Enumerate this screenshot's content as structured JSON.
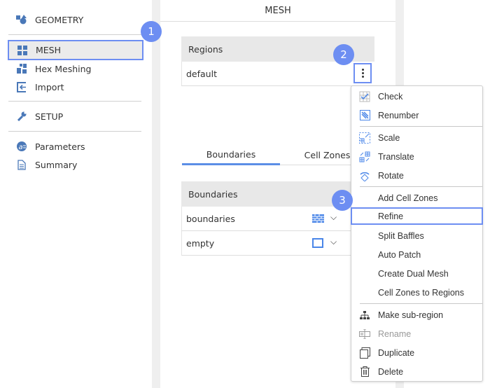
{
  "sidebar": {
    "items": [
      {
        "label": "GEOMETRY",
        "icon": "geometry-icon"
      },
      {
        "label": "MESH",
        "icon": "mesh-grid-icon",
        "selected": true
      },
      {
        "label": "Hex Meshing",
        "icon": "hex-meshing-icon"
      },
      {
        "label": "Import",
        "icon": "import-icon"
      },
      {
        "label": "SETUP",
        "icon": "wrench-icon"
      },
      {
        "label": "Parameters",
        "icon": "parameters-icon"
      },
      {
        "label": "Summary",
        "icon": "document-icon"
      }
    ]
  },
  "main": {
    "title": "MESH",
    "regions": {
      "header": "Regions",
      "rows": [
        "default"
      ],
      "menu_button_icon": "kebab-icon"
    },
    "tabs": [
      {
        "label": "Boundaries",
        "active": true
      },
      {
        "label": "Cell Zones"
      }
    ],
    "boundaries": {
      "header": "Boundaries",
      "rows": [
        {
          "label": "boundaries",
          "icon": "patch-grid-icon"
        },
        {
          "label": "empty",
          "icon": "empty-square-icon"
        }
      ]
    }
  },
  "context_menu": {
    "items": [
      {
        "label": "Check",
        "icon": "check-icon"
      },
      {
        "label": "Renumber",
        "icon": "renumber-icon"
      },
      {
        "label": "Scale",
        "icon": "scale-icon"
      },
      {
        "label": "Translate",
        "icon": "translate-icon"
      },
      {
        "label": "Rotate",
        "icon": "rotate-icon"
      },
      {
        "label": "Add Cell Zones"
      },
      {
        "label": "Refine",
        "highlighted": true
      },
      {
        "label": "Split Baffles"
      },
      {
        "label": "Auto Patch"
      },
      {
        "label": "Create Dual Mesh"
      },
      {
        "label": "Cell Zones to Regions"
      },
      {
        "label": "Make sub-region",
        "icon": "hierarchy-icon"
      },
      {
        "label": "Rename",
        "icon": "rename-icon",
        "disabled": true
      },
      {
        "label": "Duplicate",
        "icon": "duplicate-icon"
      },
      {
        "label": "Delete",
        "icon": "trash-icon"
      }
    ]
  },
  "badges": [
    "1",
    "2",
    "3"
  ],
  "colors": {
    "accent": "#4a86e8",
    "badge": "#6d8ef2",
    "selected_bg": "#ebebeb"
  }
}
